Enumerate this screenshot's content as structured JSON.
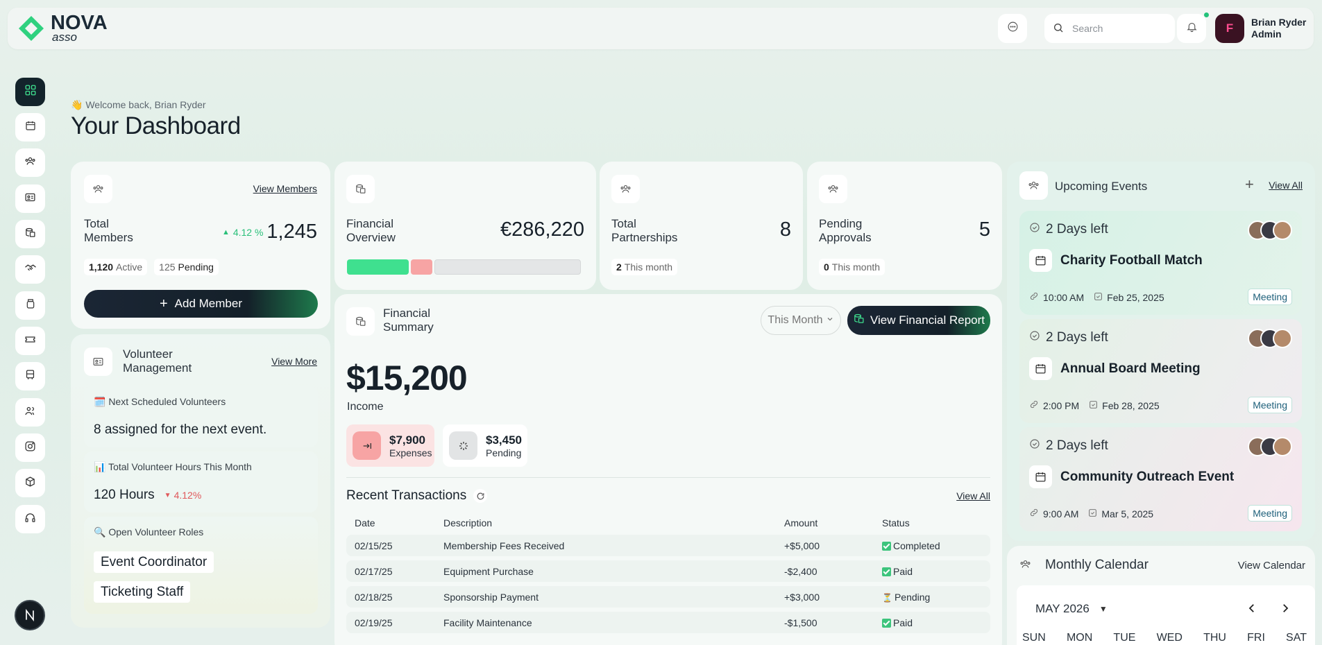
{
  "brand": {
    "name": "NOVA",
    "sub": "asso"
  },
  "header": {
    "search_placeholder": "Search",
    "user_name": "Brian Ryder",
    "user_role": "Admin",
    "avatar_letter": "F"
  },
  "welcome": "👋 Welcome back, Brian Ryder",
  "page_title": "Your Dashboard",
  "members": {
    "label_1": "Total",
    "label_2": "Members",
    "link": "View Members",
    "trend": "4.12 %",
    "value": "1,245",
    "active_num": "1,120",
    "active_lbl": "Active",
    "pending_num": "125",
    "pending_lbl": "Pending",
    "add_btn": "Add Member"
  },
  "financial_overview": {
    "label_1": "Financial",
    "label_2": "Overview",
    "value": "€286,220",
    "segments": [
      {
        "share": 0.27,
        "color": "#3fe08f"
      },
      {
        "share": 0.1,
        "color": "#f7a4a4"
      },
      {
        "share": 0.63,
        "color": "#e4e6e7"
      }
    ]
  },
  "partnerships": {
    "label_1": "Total",
    "label_2": "Partnerships",
    "value": "8",
    "pill_num": "2",
    "pill_lbl": "This month"
  },
  "approvals": {
    "label_1": "Pending",
    "label_2": "Approvals",
    "value": "5",
    "pill_num": "0",
    "pill_lbl": "This month"
  },
  "volunteer": {
    "title_1": "Volunteer",
    "title_2": "Management",
    "link": "View More",
    "next_title": "🗓️ Next Scheduled Volunteers",
    "next_value": "8 assigned for the next event.",
    "hours_title": "📊 Total Volunteer Hours This Month",
    "hours_value": "120 Hours",
    "hours_trend": "4.12%",
    "roles_title": "🔍 Open Volunteer Roles",
    "roles": [
      "Event Coordinator",
      "Ticketing Staff"
    ]
  },
  "financial_summary": {
    "title_1": "Financial",
    "title_2": "Summary",
    "period": "This Month",
    "report_btn": "View Financial Report",
    "income_value": "$15,200",
    "income_lbl": "Income",
    "expenses_value": "$7,900",
    "expenses_lbl": "Expenses",
    "pending_value": "$3,450",
    "pending_lbl": "Pending",
    "recent_title": "Recent Transactions",
    "view_all": "View All",
    "columns": [
      "Date",
      "Description",
      "Amount",
      "Status"
    ],
    "rows": [
      {
        "date": "02/15/25",
        "desc": "Membership Fees Received",
        "amount": "+$5,000",
        "status": "Completed",
        "icon": "check"
      },
      {
        "date": "02/17/25",
        "desc": "Equipment Purchase",
        "amount": "-$2,400",
        "status": "Paid",
        "icon": "check"
      },
      {
        "date": "02/18/25",
        "desc": "Sponsorship Payment",
        "amount": "+$3,000",
        "status": "Pending",
        "icon": "⏳"
      },
      {
        "date": "02/19/25",
        "desc": "Facility Maintenance",
        "amount": "-$1,500",
        "status": "Paid",
        "icon": "check"
      }
    ]
  },
  "events": {
    "title": "Upcoming Events",
    "view_all": "View All",
    "items": [
      {
        "days": "2 Days left",
        "name": "Charity Football Match",
        "time": "10:00 AM",
        "date": "Feb 25, 2025",
        "tag": "Meeting"
      },
      {
        "days": "2 Days left",
        "name": "Annual Board Meeting",
        "time": "2:00 PM",
        "date": "Feb 28, 2025",
        "tag": "Meeting"
      },
      {
        "days": "2 Days left",
        "name": "Community Outreach Event",
        "time": "9:00 AM",
        "date": "Mar 5, 2025",
        "tag": "Meeting"
      }
    ]
  },
  "calendar": {
    "title": "Monthly Calendar",
    "link": "View Calendar",
    "month": "MAY 2026",
    "days": [
      "SUN",
      "MON",
      "TUE",
      "WED",
      "THU",
      "FRI",
      "SAT"
    ]
  },
  "colors": {
    "accent": "#3fe08f",
    "dark": "#13232b",
    "danger": "#e0585b"
  }
}
